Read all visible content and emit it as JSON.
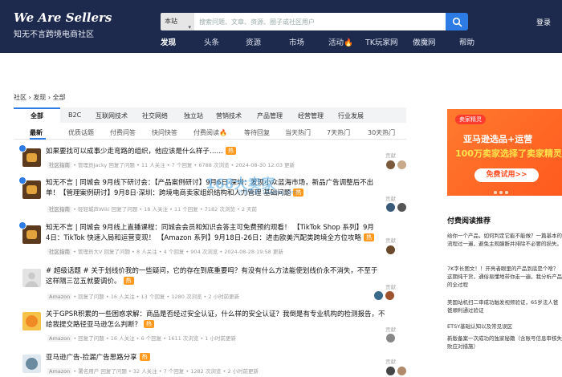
{
  "header": {
    "logo_text": "We Are Sellers",
    "logo_subtitle": "知无不言跨境电商社区",
    "search": {
      "category": "本站",
      "placeholder": "搜索问题、文章、资源、圈子或社区用户"
    },
    "login_label": "登录",
    "nav": [
      "发现",
      "头条",
      "资源",
      "市场",
      "活动",
      "TK玩家网",
      "傲魔网",
      "帮助"
    ],
    "nav_active": "发现"
  },
  "breadcrumb": "社区 › 发现 › 全部",
  "category_tabs": [
    "全部",
    "B2C",
    "互联网技术",
    "社交网络",
    "独立站",
    "营销技术",
    "产品管理",
    "经营管理",
    "行业发展"
  ],
  "filter_tabs": [
    "最新",
    "优质话题",
    "付费问答",
    "快问快答",
    "付费阅读",
    "等待回复",
    "当天热门",
    "7天热门",
    "30天热门"
  ],
  "hot_label": "热",
  "contrib_label": "贡献",
  "posts": [
    {
      "title": "如果要找可以成事少走弯路的组织，他应该是什么样子……",
      "hot": true,
      "meta": {
        "tag": "社区指南",
        "text": "• 管理员Jacky 回复了问题 • 11 人关注 • 7 个回复 • 6788 次浏览 • 2024-08-30 12:03 更新"
      }
    },
    {
      "title": "知无不言 | 同城会 9月线下研讨会：【产品案例研讨】9月6日·深圳：发现小众蓝海市场，新品广告调整后不出单！【管理案例研讨】9月8日·深圳：跨境电商卖家组织结构和人力管理 基础问题",
      "hot": true,
      "meta": {
        "tag": "社区指南",
        "text": "• 轻轻城声Wiki 回复了问题 • 18 人关注 • 11 个回复 • 7182 次浏览 • 2 天前"
      }
    },
    {
      "title": "知无不言 | 同城会 9月线上直播课程：同城会会员和知识会答主可免费预约观看！ 【TikTok Shop 系列】9月4日：TikTok 快速入局和运营变现！ 【Amazon 系列】9月18日-26日：进击欧美汽配类跨境全方位攻略",
      "hot": true,
      "meta": {
        "tag": "社区指南",
        "text": "• 管理员大V 回复了问题 • 8 人关注 • 4 个回复 • 904 次浏览 • 2024-08-28 19:58 更新"
      }
    },
    {
      "title": "# 超级话题 # 关于划线价我的一些疑问，它的存在到底重要吗？有没有什么方法能使划线价永不消失，不至于这样隔三岔五就要调价。",
      "hot": true,
      "meta": {
        "tag": "Amazon",
        "text": "• 回复了问题 • 16 人关注 • 13 个回复 • 1280 次浏览 • 2 小时前更新"
      }
    },
    {
      "title": "关于GPSR积累的一些困惑求解：商品是否经过安全认证，什么样的安全认证？我倒是有专业机构的检测报告，不给我提交路径亚马逊怎么判断？",
      "hot": true,
      "meta": {
        "tag": "Amazon",
        "text": "• 回复了问题 • 16 人关注 • 6 个回复 • 1611 次浏览 • 1 小时前更新"
      }
    },
    {
      "title": "亚马逊广告-捡漏广告思路分享",
      "hot": true,
      "meta": {
        "tag": "Amazon",
        "text": "• 署名用户 回复了问题 • 32 人关注 • 7 个回复 • 1282 次浏览 • 2 小时前更新"
      }
    }
  ],
  "right_ad": {
    "badge": "卖家精灵",
    "line1": "亚马逊选品+运营",
    "line2": "100万卖家选择了卖家精灵",
    "button": "免费试用>>"
  },
  "sidebar": {
    "title": "付费阅读推荐",
    "items": [
      "给你一个产品，如何判定它能不能做？一篇基本的流程过一遍，避免主观臆断并排除不必要的损失。",
      "7K字长图文！！开亮者眼里的产品到底是个啥？这期纯干货，通俗易懂地带你走一遍，我分析产品的全过程",
      "美国站机扫二审成功触发视频验证，65岁法人爸爸顺利通过验证",
      "ETSY基础认知以及常见误区",
      "新版备案一次成功的独家秘籍（含账号信息审核失败应对措施）"
    ]
  },
  "watermark": {
    "main": "168大卖家",
    "sub": "外贸导航 168dmj.com"
  },
  "colors": {
    "header_bg": "#1d2a4d",
    "accent": "#2d7be5",
    "hot": "#ff9a1f",
    "ad": "#ff6a26"
  }
}
